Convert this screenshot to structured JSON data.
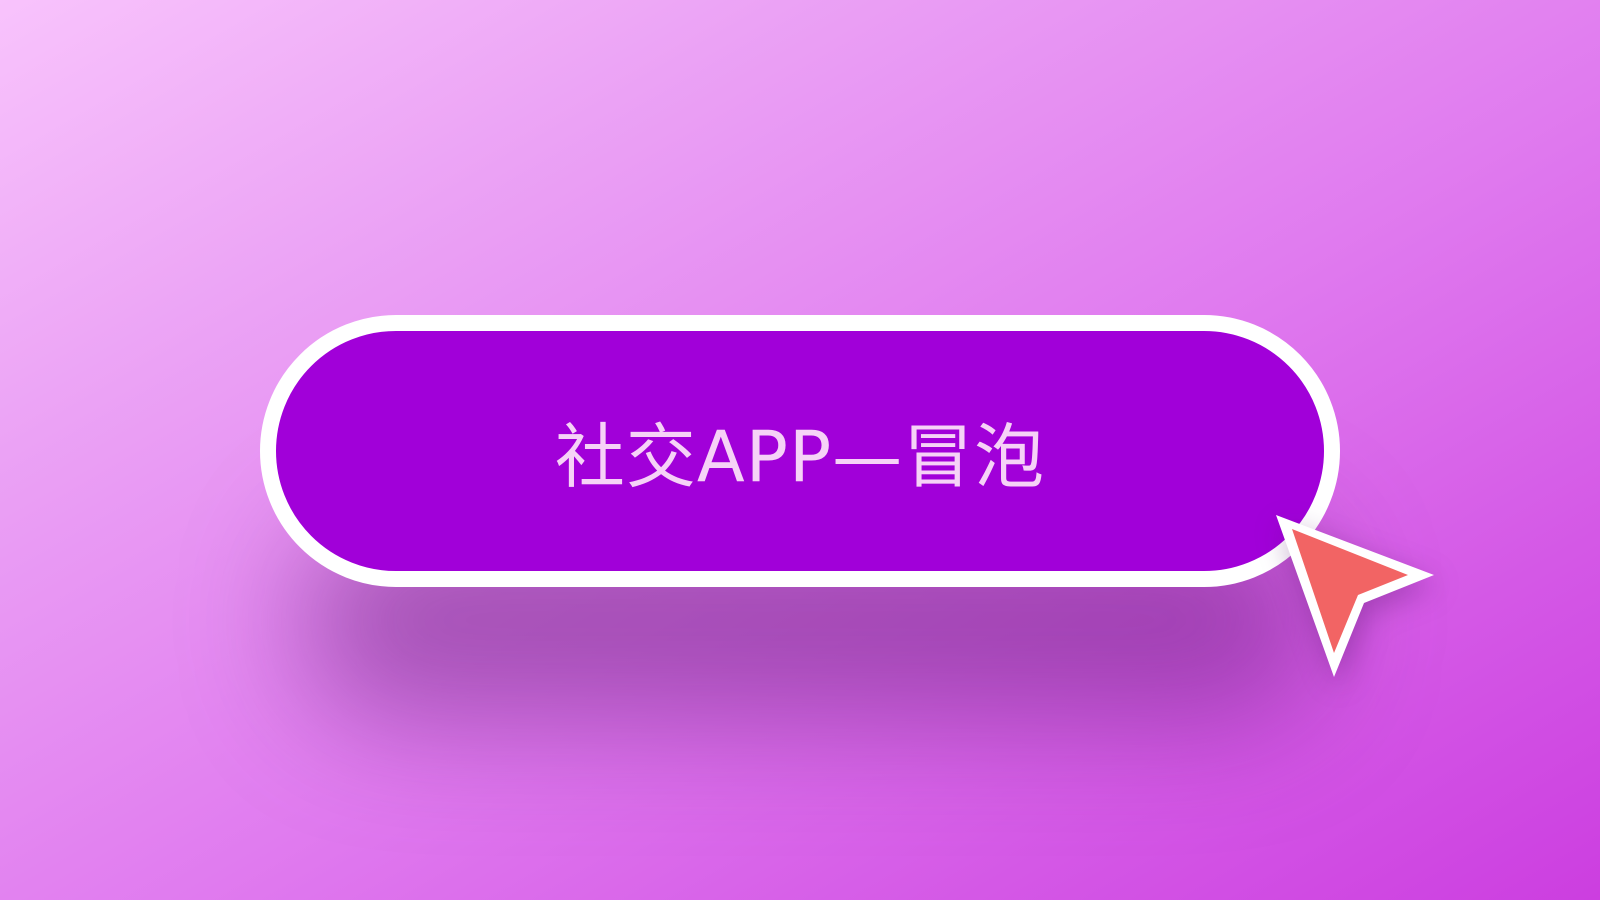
{
  "button": {
    "label": "社交APP—冒泡"
  },
  "colors": {
    "button_fill": "#a100d9",
    "button_border": "#ffffff",
    "label": "#f6d2f7",
    "cursor_fill": "#f26464"
  },
  "icons": {
    "cursor": "cursor-arrow-icon"
  }
}
